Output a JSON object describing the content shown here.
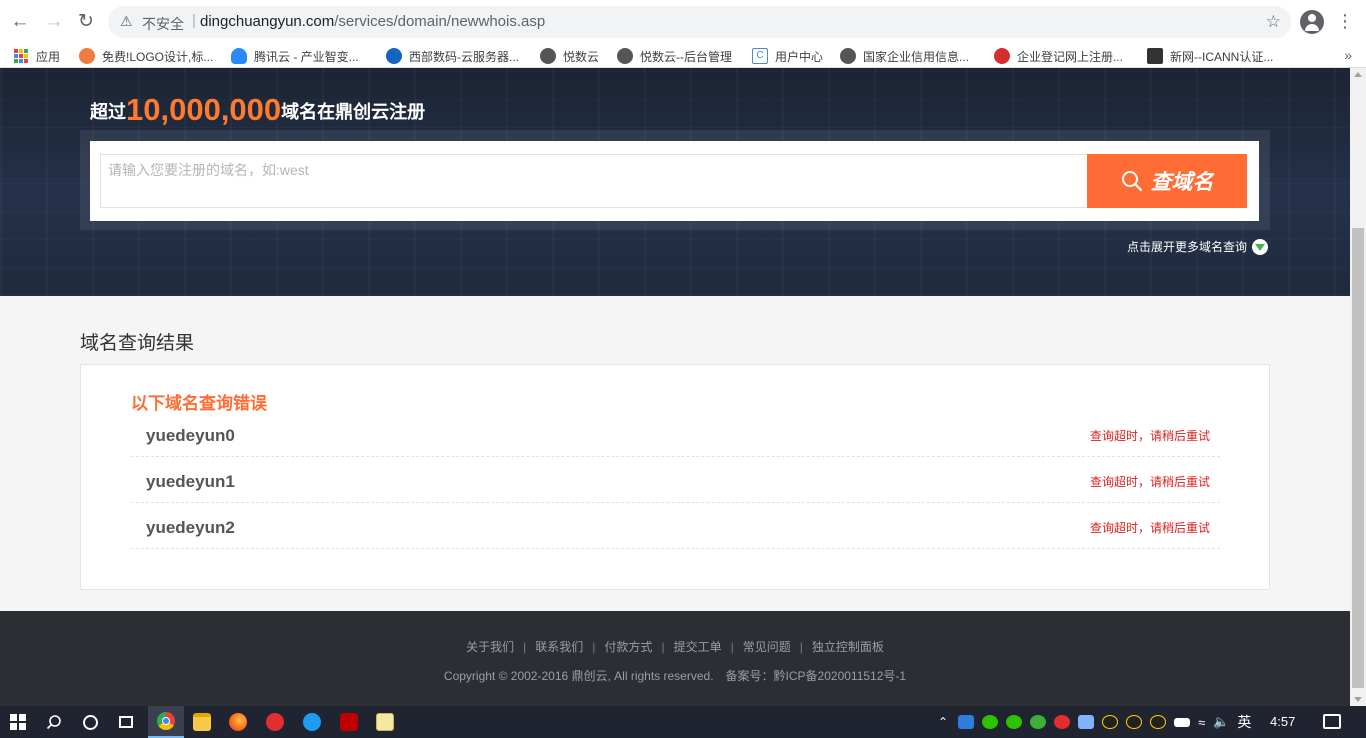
{
  "browser": {
    "security_label": "不安全",
    "url_host": "dingchuangyun.com",
    "url_path": "/services/domain/newwhois.asp",
    "bookmarks": [
      {
        "label": "应用",
        "icon": "apps-grid-icon"
      },
      {
        "label": "免费!LOGO设计,标...",
        "icon": "logo-site-icon",
        "color": "#f07b3f"
      },
      {
        "label": "腾讯云 - 产业智变...",
        "icon": "tencent-cloud-icon",
        "color": "#2b8af7"
      },
      {
        "label": "西部数码-云服务器...",
        "icon": "west-cn-icon",
        "color": "#1565c0"
      },
      {
        "label": "悦数云",
        "icon": "globe-icon",
        "color": "#555555"
      },
      {
        "label": "悦数云--后台管理",
        "icon": "globe-icon",
        "color": "#555555"
      },
      {
        "label": "用户中心",
        "icon": "user-center-icon",
        "color": "#4a8ad4"
      },
      {
        "label": "国家企业信用信息...",
        "icon": "globe-icon",
        "color": "#555555"
      },
      {
        "label": "企业登记网上注册...",
        "icon": "emblem-icon",
        "color": "#d32f2f"
      },
      {
        "label": "新网--ICANN认证...",
        "icon": "xinnet-icon",
        "color": "#333333"
      }
    ]
  },
  "hero": {
    "title_prefix": "超过",
    "title_count": "10,000,000",
    "title_suffix": "域名在鼎创云注册",
    "search_placeholder": "请输入您要注册的域名，如:west",
    "search_button": "查域名",
    "more_query": "点击展开更多域名查询"
  },
  "results": {
    "section_title": "域名查询结果",
    "error_heading": "以下域名查询错误",
    "rows": [
      {
        "domain": "yuedeyun0",
        "status": "查询超时，请稍后重试"
      },
      {
        "domain": "yuedeyun1",
        "status": "查询超时，请稍后重试"
      },
      {
        "domain": "yuedeyun2",
        "status": "查询超时，请稍后重试"
      }
    ]
  },
  "footer": {
    "links": [
      "关于我们",
      "联系我们",
      "付款方式",
      "提交工单",
      "常见问题",
      "独立控制面板"
    ],
    "copyright": "Copyright © 2002-2016 鼎创云, All rights reserved.",
    "icp": "备案号：黔ICP备2020011512号-1"
  },
  "taskbar": {
    "ime": "英",
    "clock": "4:57"
  },
  "colors": {
    "accent_orange": "#ff6d35",
    "error_red": "#e02020",
    "hero_bg": "#1f2a3d",
    "footer_bg": "#2b2e33"
  }
}
